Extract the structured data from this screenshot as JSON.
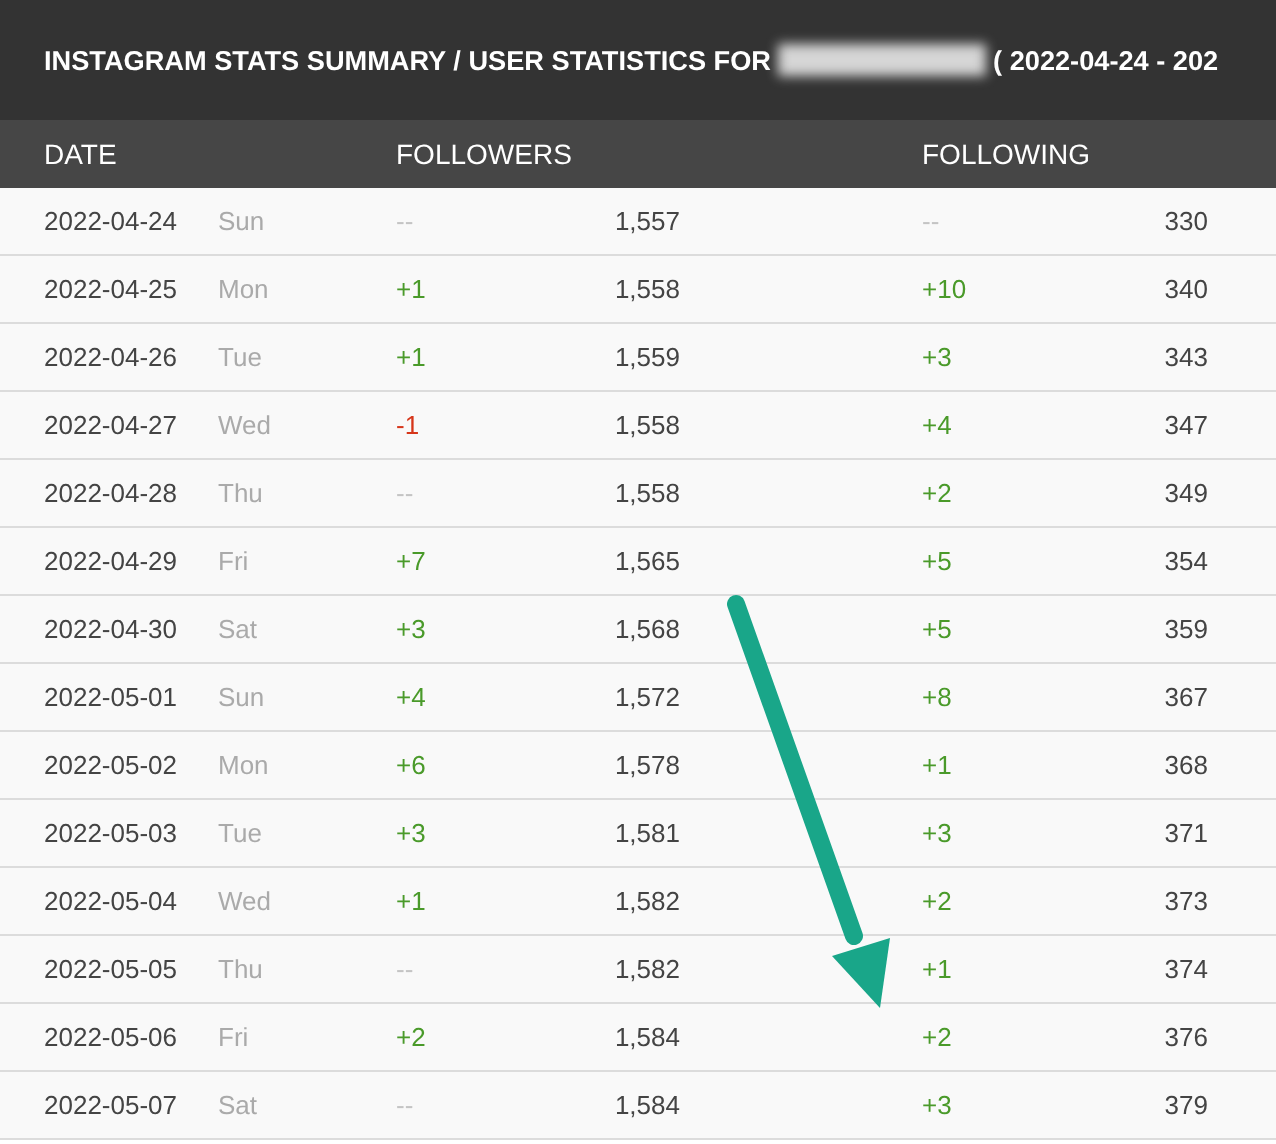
{
  "title": {
    "prefix": "INSTAGRAM STATS SUMMARY / USER STATISTICS FOR",
    "username_blurred": true,
    "suffix": "( 2022-04-24 - 202"
  },
  "columns": [
    "DATE",
    "FOLLOWERS",
    "FOLLOWING"
  ],
  "rows": [
    {
      "date": "2022-04-24",
      "day": "Sun",
      "followers_change": {
        "text": "--",
        "color": "#c4c4c4"
      },
      "followers": "1,557",
      "following_change": {
        "text": "--",
        "color": "#c4c4c4"
      },
      "following": "330"
    },
    {
      "date": "2022-04-25",
      "day": "Mon",
      "followers_change": {
        "text": "+1",
        "color": "#4a9a2a"
      },
      "followers": "1,558",
      "following_change": {
        "text": "+10",
        "color": "#4a9a2a"
      },
      "following": "340"
    },
    {
      "date": "2022-04-26",
      "day": "Tue",
      "followers_change": {
        "text": "+1",
        "color": "#4a9a2a"
      },
      "followers": "1,559",
      "following_change": {
        "text": "+3",
        "color": "#4a9a2a"
      },
      "following": "343"
    },
    {
      "date": "2022-04-27",
      "day": "Wed",
      "followers_change": {
        "text": "-1",
        "color": "#d6361a"
      },
      "followers": "1,558",
      "following_change": {
        "text": "+4",
        "color": "#4a9a2a"
      },
      "following": "347"
    },
    {
      "date": "2022-04-28",
      "day": "Thu",
      "followers_change": {
        "text": "--",
        "color": "#c4c4c4"
      },
      "followers": "1,558",
      "following_change": {
        "text": "+2",
        "color": "#4a9a2a"
      },
      "following": "349"
    },
    {
      "date": "2022-04-29",
      "day": "Fri",
      "followers_change": {
        "text": "+7",
        "color": "#4a9a2a"
      },
      "followers": "1,565",
      "following_change": {
        "text": "+5",
        "color": "#4a9a2a"
      },
      "following": "354"
    },
    {
      "date": "2022-04-30",
      "day": "Sat",
      "followers_change": {
        "text": "+3",
        "color": "#4a9a2a"
      },
      "followers": "1,568",
      "following_change": {
        "text": "+5",
        "color": "#4a9a2a"
      },
      "following": "359"
    },
    {
      "date": "2022-05-01",
      "day": "Sun",
      "followers_change": {
        "text": "+4",
        "color": "#4a9a2a"
      },
      "followers": "1,572",
      "following_change": {
        "text": "+8",
        "color": "#4a9a2a"
      },
      "following": "367"
    },
    {
      "date": "2022-05-02",
      "day": "Mon",
      "followers_change": {
        "text": "+6",
        "color": "#4a9a2a"
      },
      "followers": "1,578",
      "following_change": {
        "text": "+1",
        "color": "#4a9a2a"
      },
      "following": "368"
    },
    {
      "date": "2022-05-03",
      "day": "Tue",
      "followers_change": {
        "text": "+3",
        "color": "#4a9a2a"
      },
      "followers": "1,581",
      "following_change": {
        "text": "+3",
        "color": "#4a9a2a"
      },
      "following": "371"
    },
    {
      "date": "2022-05-04",
      "day": "Wed",
      "followers_change": {
        "text": "+1",
        "color": "#4a9a2a"
      },
      "followers": "1,582",
      "following_change": {
        "text": "+2",
        "color": "#4a9a2a"
      },
      "following": "373"
    },
    {
      "date": "2022-05-05",
      "day": "Thu",
      "followers_change": {
        "text": "--",
        "color": "#c4c4c4"
      },
      "followers": "1,582",
      "following_change": {
        "text": "+1",
        "color": "#4a9a2a"
      },
      "following": "374"
    },
    {
      "date": "2022-05-06",
      "day": "Fri",
      "followers_change": {
        "text": "+2",
        "color": "#4a9a2a"
      },
      "followers": "1,584",
      "following_change": {
        "text": "+2",
        "color": "#4a9a2a"
      },
      "following": "376"
    },
    {
      "date": "2022-05-07",
      "day": "Sat",
      "followers_change": {
        "text": "--",
        "color": "#c4c4c4"
      },
      "followers": "1,584",
      "following_change": {
        "text": "+3",
        "color": "#4a9a2a"
      },
      "following": "379"
    }
  ]
}
